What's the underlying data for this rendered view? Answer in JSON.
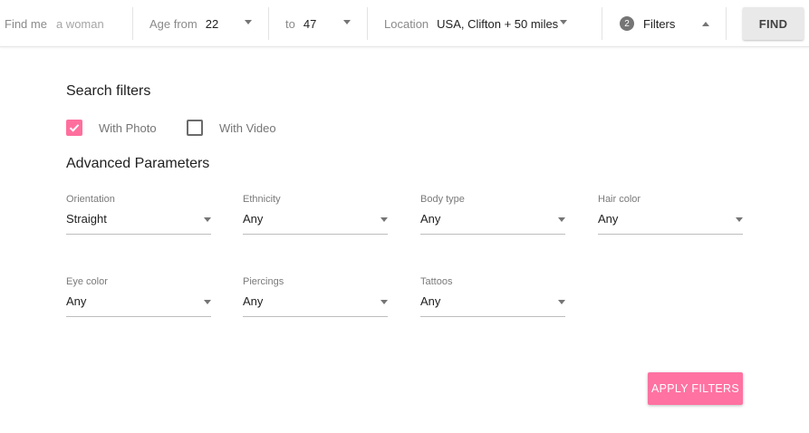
{
  "search_bar": {
    "find_me_label": "Find me",
    "find_me_value": "a woman",
    "age_from_label": "Age from",
    "age_from_value": "22",
    "age_to_label": "to",
    "age_to_value": "47",
    "location_label": "Location",
    "location_value": "USA, Clifton + 50 miles",
    "filters_count": "2",
    "filters_label": "Filters",
    "find_button": "FIND"
  },
  "panel": {
    "search_filters_title": "Search filters",
    "with_photo_label": "With Photo",
    "with_photo_checked": true,
    "with_video_label": "With Video",
    "with_video_checked": false,
    "advanced_title": "Advanced Parameters",
    "fields": [
      {
        "label": "Orientation",
        "value": "Straight"
      },
      {
        "label": "Ethnicity",
        "value": "Any"
      },
      {
        "label": "Body type",
        "value": "Any"
      },
      {
        "label": "Hair color",
        "value": "Any"
      },
      {
        "label": "Eye color",
        "value": "Any"
      },
      {
        "label": "Piercings",
        "value": "Any"
      },
      {
        "label": "Tattoos",
        "value": "Any"
      }
    ],
    "apply_button": "APPLY FILTERS"
  },
  "colors": {
    "accent": "#ff6f9e",
    "find_button_bg": "#e9e9e9"
  }
}
